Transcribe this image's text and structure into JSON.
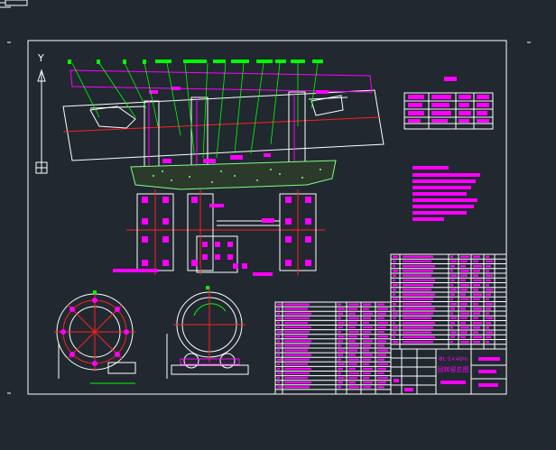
{
  "colors": {
    "background": "#212830",
    "frame": "#ffffff",
    "magenta": "#ff00ff",
    "green": "#00ff00",
    "red": "#ff2020",
    "grid": "#ffffff"
  },
  "ucs": {
    "y_label": "Y"
  },
  "title_block": {
    "line1": "ΦL·5×40m",
    "line2": "回转窑总图"
  },
  "icons": {
    "ucs": "ucs-axis-icon",
    "tab": "drawing-tab-icon"
  }
}
